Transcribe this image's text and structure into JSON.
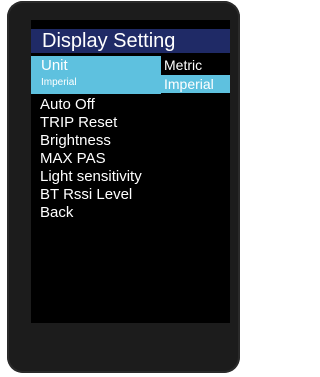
{
  "screen": {
    "title": "Display Setting",
    "unit": {
      "label": "Unit",
      "current_value": "Imperial"
    },
    "unit_options": [
      "Metric",
      "Imperial"
    ],
    "menu_items": [
      "Auto Off",
      "TRIP Reset",
      "Brightness",
      "MAX PAS",
      "Light sensitivity",
      "BT Rssi Level",
      "Back"
    ]
  },
  "colors": {
    "title_bar": "#1f2a66",
    "highlight": "#5ec1df",
    "screen_background": "#000000",
    "bezel": "#1c1c1c",
    "text": "#ffffff"
  }
}
